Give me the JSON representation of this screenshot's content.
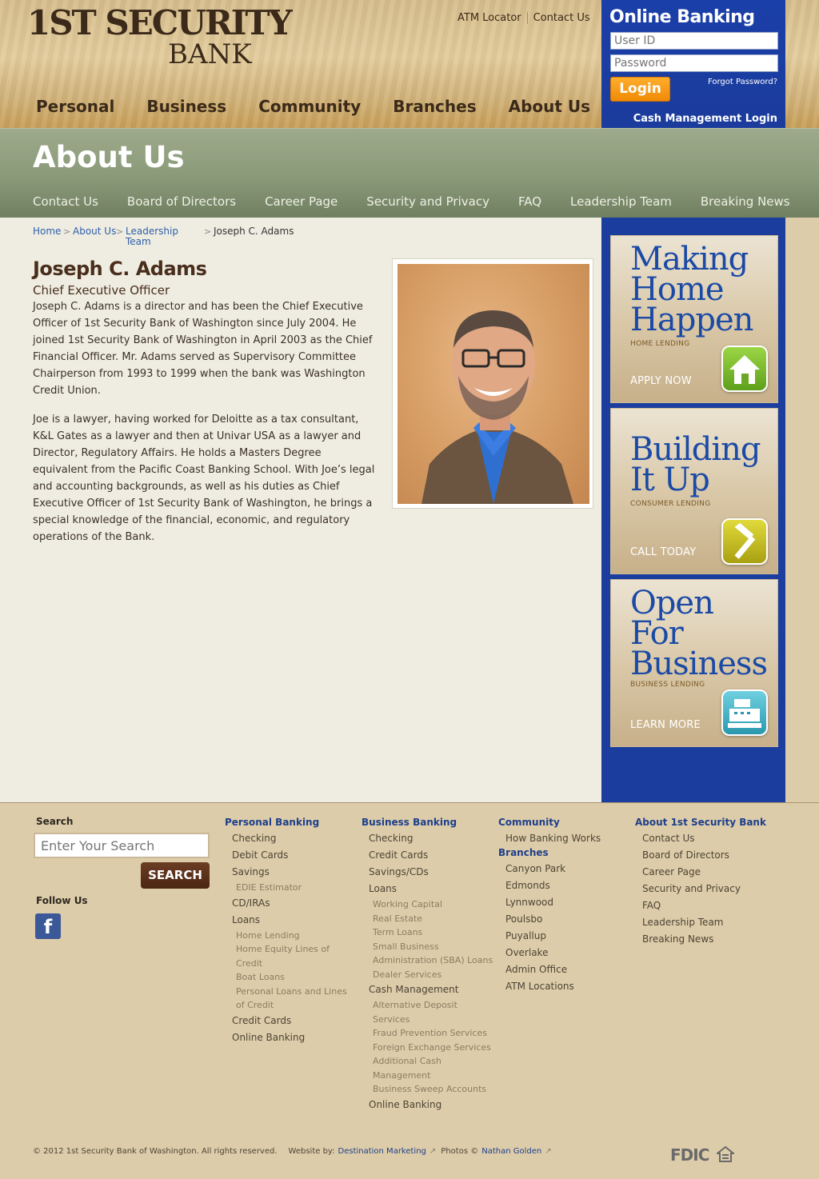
{
  "header": {
    "logo_top": "1ST SECURITY",
    "logo_bottom": "BANK",
    "util_links": [
      "ATM Locator",
      "Contact Us"
    ],
    "main_nav": [
      "Personal",
      "Business",
      "Community",
      "Branches",
      "About Us"
    ]
  },
  "online_banking": {
    "title": "Online Banking",
    "userid_placeholder": "User ID",
    "password_placeholder": "Password",
    "login_label": "Login",
    "forgot_password": "Forgot Password?",
    "cash_management_login": "Cash Management Login"
  },
  "section": {
    "title": "About Us",
    "sub_nav": [
      "Contact Us",
      "Board of Directors",
      "Career Page",
      "Security and Privacy",
      "FAQ",
      "Leadership Team",
      "Breaking News"
    ]
  },
  "breadcrumb": {
    "home": "Home",
    "about": "About Us",
    "leadership_1": "Leadership",
    "leadership_2": "Team",
    "current": "Joseph C. Adams"
  },
  "profile": {
    "name": "Joseph C. Adams",
    "title": "Chief Executive Officer",
    "bio_1": "Joseph C. Adams is a director and has been the Chief Executive Officer of 1st Security Bank of Washington since July 2004. He joined 1st Security Bank of Washington in April 2003 as the Chief Financial Officer. Mr. Adams served as Supervisory Committee Chairperson from 1993 to 1999 when the bank was Washington Credit Union.",
    "bio_2": "Joe is a lawyer, having worked for Deloitte as a tax consultant, K&L Gates as a lawyer and then at Univar USA as a lawyer and Director, Regulatory Affairs. He holds a Masters Degree equivalent from the Pacific Coast Banking School. With Joe’s legal and accounting backgrounds, as well as his duties as Chief Executive Officer of 1st Security Bank of Washington, he brings a special knowledge of the financial, economic, and regulatory operations of the Bank."
  },
  "promos": [
    {
      "line1": "Making",
      "line2": "Home",
      "line3": "Happen",
      "sub": "HOME LENDING",
      "cta": "APPLY NOW",
      "icon": "house-icon",
      "icon_color": "#7bbf2a"
    },
    {
      "line1": "Building",
      "line2": "It Up",
      "line3": "",
      "sub": "CONSUMER LENDING",
      "cta": "CALL TODAY",
      "icon": "hammer-icon",
      "icon_color": "#c9c21c"
    },
    {
      "line1": "Open",
      "line2": "For",
      "line3": "Business",
      "sub": "BUSINESS LENDING",
      "cta": "LEARN MORE",
      "icon": "cash-register-icon",
      "icon_color": "#38b4c9"
    }
  ],
  "footer": {
    "search_label": "Search",
    "search_placeholder": "Enter Your Search",
    "search_button": "SEARCH",
    "follow_label": "Follow Us",
    "facebook": "f",
    "personal": {
      "head": "Personal Banking",
      "items": [
        "Checking",
        "Debit Cards",
        "Savings"
      ],
      "savings_sub": [
        "EDIE Estimator"
      ],
      "items2": [
        "CD/IRAs",
        "Loans"
      ],
      "loans_sub": [
        "Home Lending",
        "Home Equity Lines of",
        "Credit",
        "Boat Loans",
        "Personal Loans and Lines",
        "of Credit"
      ],
      "items3": [
        "Credit Cards",
        "Online Banking"
      ]
    },
    "business": {
      "head": "Business Banking",
      "items": [
        "Checking",
        "Credit Cards",
        "Savings/CDs",
        "Loans"
      ],
      "loans_sub": [
        "Working Capital",
        "Real Estate",
        "Term Loans",
        "Small Business",
        "Administration (SBA) Loans",
        "Dealer Services"
      ],
      "items2": [
        "Cash Management"
      ],
      "cash_sub": [
        "Alternative Deposit",
        "Services",
        "Fraud Prevention Services",
        "Foreign Exchange Services",
        "Additional Cash",
        "Management",
        "Business Sweep Accounts"
      ],
      "items3": [
        "Online Banking"
      ]
    },
    "community": {
      "head": "Community",
      "items": [
        "How Banking Works"
      ],
      "branches_head": "Branches",
      "branches": [
        "Canyon Park",
        "Edmonds",
        "Lynnwood",
        "Poulsbo",
        "Puyallup",
        "Overlake",
        "Admin Office",
        "ATM Locations"
      ]
    },
    "about": {
      "head": "About 1st Security Bank",
      "items": [
        "Contact Us",
        "Board of Directors",
        "Career Page",
        "Security and Privacy",
        "FAQ",
        "Leadership Team",
        "Breaking News"
      ]
    },
    "copyright": "© 2012 1st Security Bank of Washington. All rights reserved.",
    "website_by_label": "Website by:",
    "website_by": "Destination Marketing",
    "photos_label": "Photos ©",
    "photos_by": "Nathan Golden",
    "fdic": "FDIC"
  }
}
